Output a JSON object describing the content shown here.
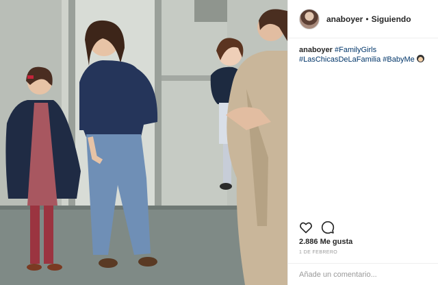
{
  "post": {
    "photo_subject": "",
    "header": {
      "username": "anaboyer",
      "separator": "•",
      "follow_label": "Siguiendo"
    },
    "caption": {
      "username": "anaboyer",
      "hashtags": [
        "#FamilyGirls",
        "#LasChicasDeLaFamilia",
        "#BabyMe"
      ],
      "emoji": "👧"
    },
    "actions": {
      "like_icon": "heart-icon",
      "comment_icon": "speech-bubble-icon"
    },
    "likes_text": "2.886 Me gusta",
    "date_text": "1 DE FEBRERO",
    "comment": {
      "placeholder": "Añade un comentario...",
      "value": ""
    }
  },
  "colors": {
    "hashtag": "#003569",
    "text": "#262626",
    "muted": "#999999",
    "divider": "#efefef"
  }
}
